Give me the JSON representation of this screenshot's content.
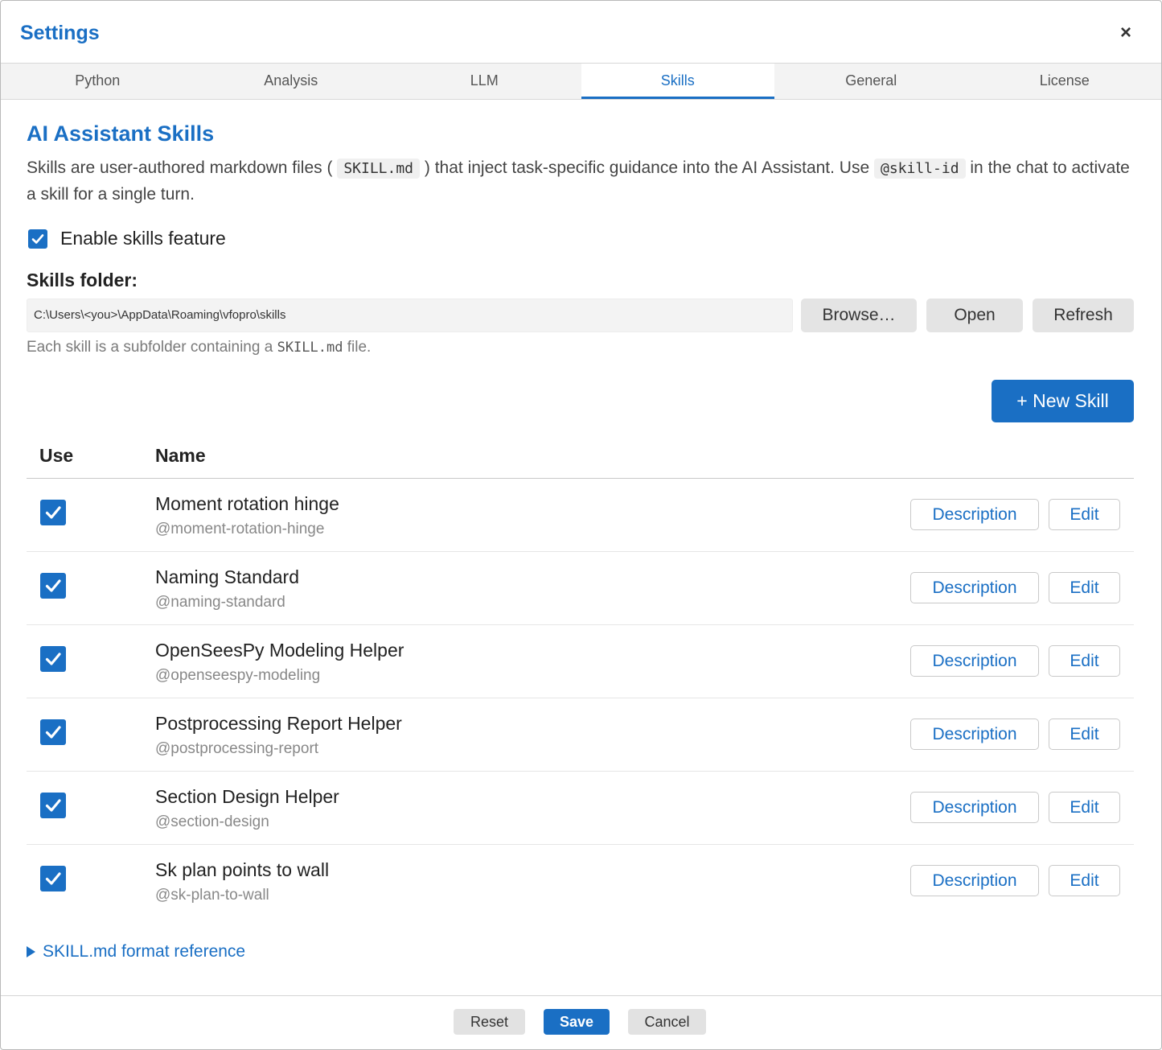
{
  "dialog": {
    "title": "Settings",
    "close_glyph": "×"
  },
  "tabs": [
    {
      "label": "Python",
      "active": false
    },
    {
      "label": "Analysis",
      "active": false
    },
    {
      "label": "LLM",
      "active": false
    },
    {
      "label": "Skills",
      "active": true
    },
    {
      "label": "General",
      "active": false
    },
    {
      "label": "License",
      "active": false
    }
  ],
  "skills_page": {
    "title": "AI Assistant Skills",
    "intro_before": "Skills are user-authored markdown files (",
    "intro_code1": "SKILL.md",
    "intro_middle": ") that inject task-specific guidance into the AI Assistant. Use",
    "intro_code2": "@skill-id",
    "intro_after": "in the chat to activate a skill for a single turn.",
    "enable_label": "Enable skills feature",
    "enable_checked": true,
    "folder_label": "Skills folder:",
    "folder_path": "C:\\Users\\<you>\\AppData\\Roaming\\vfopro\\skills",
    "browse_label": "Browse…",
    "open_label": "Open",
    "refresh_label": "Refresh",
    "hint_before": "Each skill is a subfolder containing a",
    "hint_code": "SKILL.md",
    "hint_after": "file.",
    "new_skill_label": "+ New Skill",
    "table": {
      "col_use": "Use",
      "col_name": "Name",
      "description_label": "Description",
      "edit_label": "Edit",
      "rows": [
        {
          "name": "Moment rotation hinge",
          "id": "@moment-rotation-hinge",
          "enabled": true
        },
        {
          "name": "Naming Standard",
          "id": "@naming-standard",
          "enabled": true
        },
        {
          "name": "OpenSeesPy Modeling Helper",
          "id": "@openseespy-modeling",
          "enabled": true
        },
        {
          "name": "Postprocessing Report Helper",
          "id": "@postprocessing-report",
          "enabled": true
        },
        {
          "name": "Section Design Helper",
          "id": "@section-design",
          "enabled": true
        },
        {
          "name": "Sk plan points to wall",
          "id": "@sk-plan-to-wall",
          "enabled": true
        }
      ]
    },
    "format_ref_label": "SKILL.md format reference"
  },
  "footer": {
    "reset_label": "Reset",
    "save_label": "Save",
    "cancel_label": "Cancel"
  },
  "colors": {
    "accent": "#1a6fc4",
    "tab_bar": "#f3f3f3",
    "button_gray": "#e4e4e4"
  },
  "icons": {
    "checkbox": "checkmark-icon",
    "close": "close-icon",
    "disclosure": "triangle-right-icon"
  }
}
